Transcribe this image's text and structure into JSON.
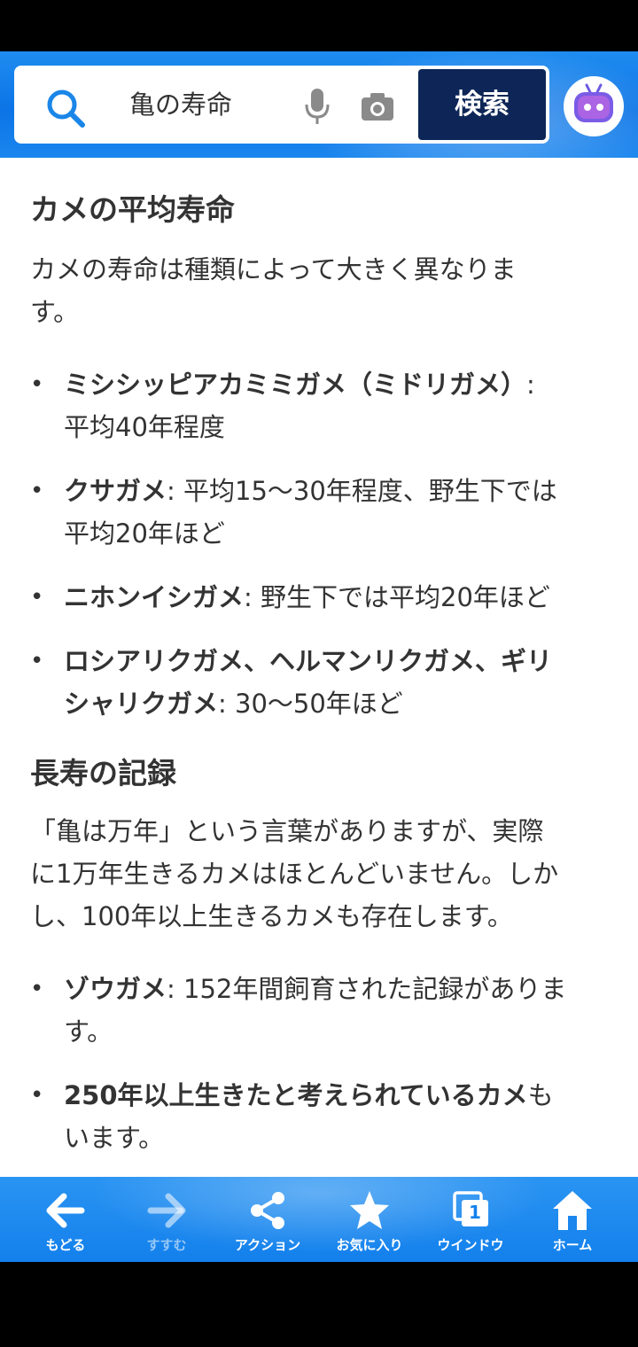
{
  "search": {
    "query": "亀の寿命",
    "button_label": "検索"
  },
  "content": {
    "section1_heading": "カメの平均寿命",
    "section1_para_line1": "カメの寿命は種類によって大きく異なりま",
    "section1_para_line2": "す。",
    "bullets1": [
      {
        "bold": "ミシシッピアカミミガメ（ミドリガメ）",
        "rest_line1": ":",
        "line2": "平均40年程度"
      },
      {
        "bold": "クサガメ",
        "rest_line1": ": 平均15〜30年程度、野生下では",
        "line2": "平均20年ほど"
      },
      {
        "bold": "ニホンイシガメ",
        "rest_line1": ": 野生下では平均20年ほど",
        "line2": ""
      },
      {
        "bold_line1": "ロシアリクガメ、ヘルマンリクガメ、ギリ",
        "bold_line2": "シャリクガメ",
        "rest_line2": ": 30〜50年ほど"
      }
    ],
    "section2_heading": "長寿の記録",
    "section2_para_line1": "「亀は万年」という言葉がありますが、実際",
    "section2_para_line2": "に1万年生きるカメはほとんどいません。しか",
    "section2_para_line3": "し、100年以上生きるカメも存在します。",
    "bullets2": [
      {
        "bold": "ゾウガメ",
        "rest_line1": ": 152年間飼育された記録がありま",
        "line2": "す。"
      },
      {
        "bold": "250年以上生きたと考えられているカメ",
        "rest_line1": "も",
        "line2": "います。"
      }
    ]
  },
  "toolbar": {
    "items": [
      {
        "label": "もどる",
        "icon": "arrow-left-icon"
      },
      {
        "label": "すすむ",
        "icon": "arrow-right-icon"
      },
      {
        "label": "アクション",
        "icon": "share-icon"
      },
      {
        "label": "お気に入り",
        "icon": "star-icon"
      },
      {
        "label": "ウインドウ",
        "icon": "windows-icon",
        "count": "1"
      },
      {
        "label": "ホーム",
        "icon": "home-icon"
      }
    ]
  },
  "colors": {
    "header_blue": "#0c74e6",
    "search_button": "#0d2657",
    "text": "#333333"
  }
}
